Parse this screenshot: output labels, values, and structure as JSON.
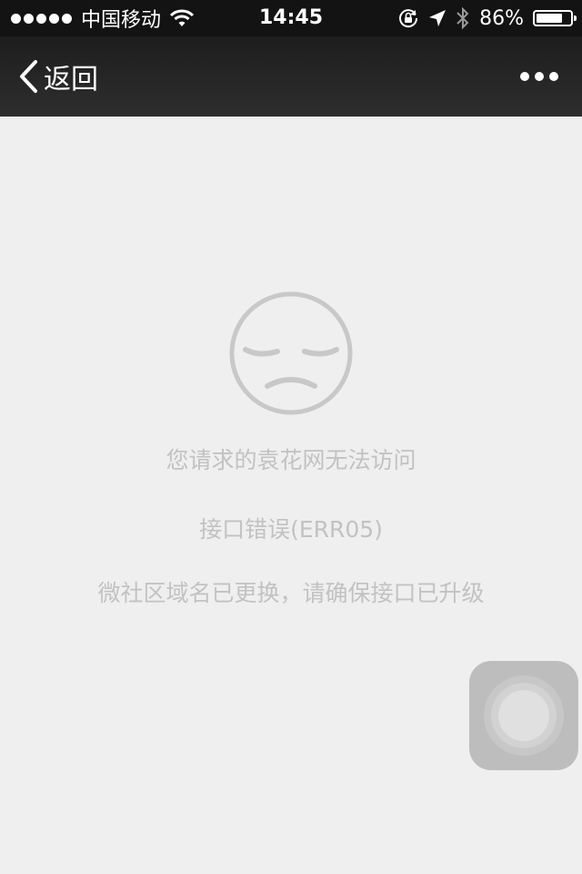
{
  "status_bar": {
    "carrier": "中国移动",
    "time": "14:45",
    "battery_percent": "86%",
    "battery_level": 0.86,
    "icons": [
      "signal-dots-icon",
      "wifi-icon",
      "rotation-lock-icon",
      "location-arrow-icon",
      "bluetooth-icon",
      "battery-icon"
    ]
  },
  "nav": {
    "back_label": "返回",
    "back_icon": "chevron-left-icon",
    "more_icon": "more-dots-icon"
  },
  "error": {
    "face_icon": "sad-face-icon",
    "title": "您请求的袁花网无法访问",
    "code": "接口错误(ERR05)",
    "hint": "微社区域名已更换，请确保接口已升级"
  },
  "assistive_touch": {
    "icon": "assistive-touch-icon"
  },
  "colors": {
    "background": "#efefef",
    "navbar": "#2a2a2a",
    "message_text": "#c2c2c2",
    "face_stroke": "#c8c8c8"
  }
}
